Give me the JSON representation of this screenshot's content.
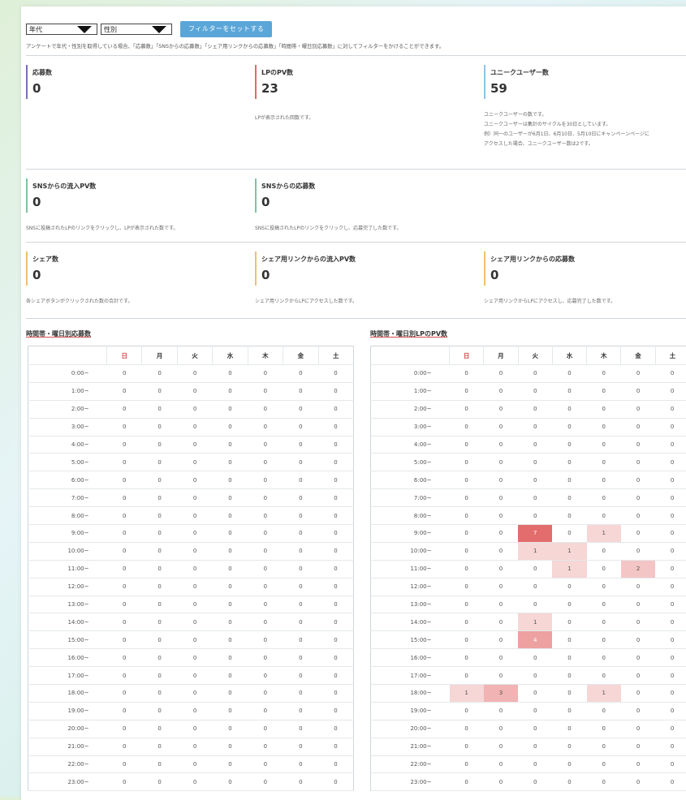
{
  "filters": {
    "age_select": "年代",
    "gender_select": "性別",
    "set_button": "フィルターをセットする",
    "note": "アンケートで年代・性別を取得している場合、「応募数」「SNSからの応募数」「シェア用リンクからの応募数」「時間帯・曜日別応募数」に対してフィルターをかけることができます。"
  },
  "colors": {
    "accent_blue": "#5aa6d8",
    "bar_purple": "#7b6ebd",
    "bar_red": "#e06a6a",
    "bar_lightblue": "#8fc4e6",
    "bar_green": "#7cc4a0",
    "bar_orange": "#f0c070",
    "heat": "#e05a5a"
  },
  "metrics": {
    "applications": {
      "label": "応募数",
      "value": "0"
    },
    "lp_pv": {
      "label": "LPのPV数",
      "value": "23",
      "desc": "LPが表示された回数です。"
    },
    "unique_users": {
      "label": "ユニークユーザー数",
      "value": "59",
      "desc_lines": [
        "ユニークユーザーの数です。",
        "ユニークユーザーは集計のサイクルを30日としています。",
        "例）同一のユーザーが6月1日、6月10日、5月10日にキャンペーンページに",
        "アクセスした場合、ユニークユーザー数は2です。"
      ]
    },
    "sns_inflow_pv": {
      "label": "SNSからの流入PV数",
      "value": "0",
      "desc": "SNSに投稿されたLPのリンクをクリックし、LPが表示された数です。"
    },
    "sns_applications": {
      "label": "SNSからの応募数",
      "value": "0",
      "desc": "SNSに投稿されたLPのリンクをクリックし、応募完了した数です。"
    },
    "shares": {
      "label": "シェア数",
      "value": "0",
      "desc": "各シェアボタンがクリックされた数の合計です。"
    },
    "share_link_pv": {
      "label": "シェア用リンクからの流入PV数",
      "value": "0",
      "desc": "シェア用リンクからLPにアクセスした数です。"
    },
    "share_link_applications": {
      "label": "シェア用リンクからの応募数",
      "value": "0",
      "desc": "シェア用リンクからLPにアクセスし、応募完了した数です。"
    }
  },
  "weekdays": [
    "日",
    "月",
    "火",
    "水",
    "木",
    "金",
    "土"
  ],
  "hours": [
    "0:00~",
    "1:00~",
    "2:00~",
    "3:00~",
    "4:00~",
    "5:00~",
    "6:00~",
    "7:00~",
    "8:00~",
    "9:00~",
    "10:00~",
    "11:00~",
    "12:00~",
    "13:00~",
    "14:00~",
    "15:00~",
    "16:00~",
    "17:00~",
    "18:00~",
    "19:00~",
    "20:00~",
    "21:00~",
    "22:00~",
    "23:00~"
  ],
  "applications_table": {
    "title": "時間帯・曜日別応募数",
    "rows": [
      [
        0,
        0,
        0,
        0,
        0,
        0,
        0
      ],
      [
        0,
        0,
        0,
        0,
        0,
        0,
        0
      ],
      [
        0,
        0,
        0,
        0,
        0,
        0,
        0
      ],
      [
        0,
        0,
        0,
        0,
        0,
        0,
        0
      ],
      [
        0,
        0,
        0,
        0,
        0,
        0,
        0
      ],
      [
        0,
        0,
        0,
        0,
        0,
        0,
        0
      ],
      [
        0,
        0,
        0,
        0,
        0,
        0,
        0
      ],
      [
        0,
        0,
        0,
        0,
        0,
        0,
        0
      ],
      [
        0,
        0,
        0,
        0,
        0,
        0,
        0
      ],
      [
        0,
        0,
        0,
        0,
        0,
        0,
        0
      ],
      [
        0,
        0,
        0,
        0,
        0,
        0,
        0
      ],
      [
        0,
        0,
        0,
        0,
        0,
        0,
        0
      ],
      [
        0,
        0,
        0,
        0,
        0,
        0,
        0
      ],
      [
        0,
        0,
        0,
        0,
        0,
        0,
        0
      ],
      [
        0,
        0,
        0,
        0,
        0,
        0,
        0
      ],
      [
        0,
        0,
        0,
        0,
        0,
        0,
        0
      ],
      [
        0,
        0,
        0,
        0,
        0,
        0,
        0
      ],
      [
        0,
        0,
        0,
        0,
        0,
        0,
        0
      ],
      [
        0,
        0,
        0,
        0,
        0,
        0,
        0
      ],
      [
        0,
        0,
        0,
        0,
        0,
        0,
        0
      ],
      [
        0,
        0,
        0,
        0,
        0,
        0,
        0
      ],
      [
        0,
        0,
        0,
        0,
        0,
        0,
        0
      ],
      [
        0,
        0,
        0,
        0,
        0,
        0,
        0
      ],
      [
        0,
        0,
        0,
        0,
        0,
        0,
        0
      ]
    ]
  },
  "lp_pv_table": {
    "title": "時間帯・曜日別LPのPV数",
    "rows": [
      [
        0,
        0,
        0,
        0,
        0,
        0,
        0
      ],
      [
        0,
        0,
        0,
        0,
        0,
        0,
        0
      ],
      [
        0,
        0,
        0,
        0,
        0,
        0,
        0
      ],
      [
        0,
        0,
        0,
        0,
        0,
        0,
        0
      ],
      [
        0,
        0,
        0,
        0,
        0,
        0,
        0
      ],
      [
        0,
        0,
        0,
        0,
        0,
        0,
        0
      ],
      [
        0,
        0,
        0,
        0,
        0,
        0,
        0
      ],
      [
        0,
        0,
        0,
        0,
        0,
        0,
        0
      ],
      [
        0,
        0,
        0,
        0,
        0,
        0,
        0
      ],
      [
        0,
        0,
        7,
        0,
        1,
        0,
        0
      ],
      [
        0,
        0,
        1,
        1,
        0,
        0,
        0
      ],
      [
        0,
        0,
        0,
        1,
        0,
        2,
        0
      ],
      [
        0,
        0,
        0,
        0,
        0,
        0,
        0
      ],
      [
        0,
        0,
        0,
        0,
        0,
        0,
        0
      ],
      [
        0,
        0,
        1,
        0,
        0,
        0,
        0
      ],
      [
        0,
        0,
        4,
        0,
        0,
        0,
        0
      ],
      [
        0,
        0,
        0,
        0,
        0,
        0,
        0
      ],
      [
        0,
        0,
        0,
        0,
        0,
        0,
        0
      ],
      [
        1,
        3,
        0,
        0,
        1,
        0,
        0
      ],
      [
        0,
        0,
        0,
        0,
        0,
        0,
        0
      ],
      [
        0,
        0,
        0,
        0,
        0,
        0,
        0
      ],
      [
        0,
        0,
        0,
        0,
        0,
        0,
        0
      ],
      [
        0,
        0,
        0,
        0,
        0,
        0,
        0
      ],
      [
        0,
        0,
        0,
        0,
        0,
        0,
        0
      ]
    ]
  }
}
